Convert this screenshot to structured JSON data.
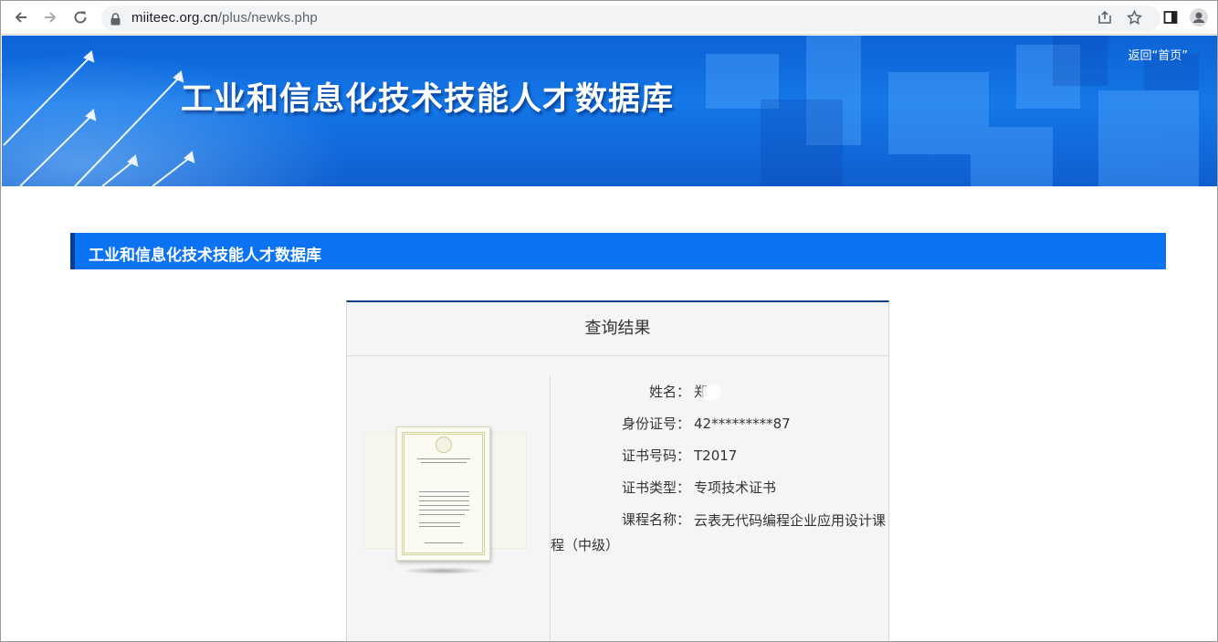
{
  "browser": {
    "url_host": "miiteec.org.cn",
    "url_path": "/plus/newks.php"
  },
  "banner": {
    "title": "工业和信息化技术技能人才数据库",
    "home_link": "返回“首页”"
  },
  "section": {
    "title": "工业和信息化技术技能人才数据库"
  },
  "result": {
    "title": "查询结果",
    "fields": [
      {
        "label": "姓名：",
        "value": "郑"
      },
      {
        "label": "身份证号：",
        "value": "42*********87"
      },
      {
        "label": "证书号码：",
        "value": "T2017"
      },
      {
        "label": "证书类型：",
        "value": "专项技术证书"
      },
      {
        "label": "课程名称：",
        "value": "云表无代码编程企业应用设计课程（中级）"
      }
    ]
  },
  "colors": {
    "banner_blue": "#1477e8",
    "section_blue": "#0b73f2",
    "card_top_border": "#0a3d86"
  }
}
